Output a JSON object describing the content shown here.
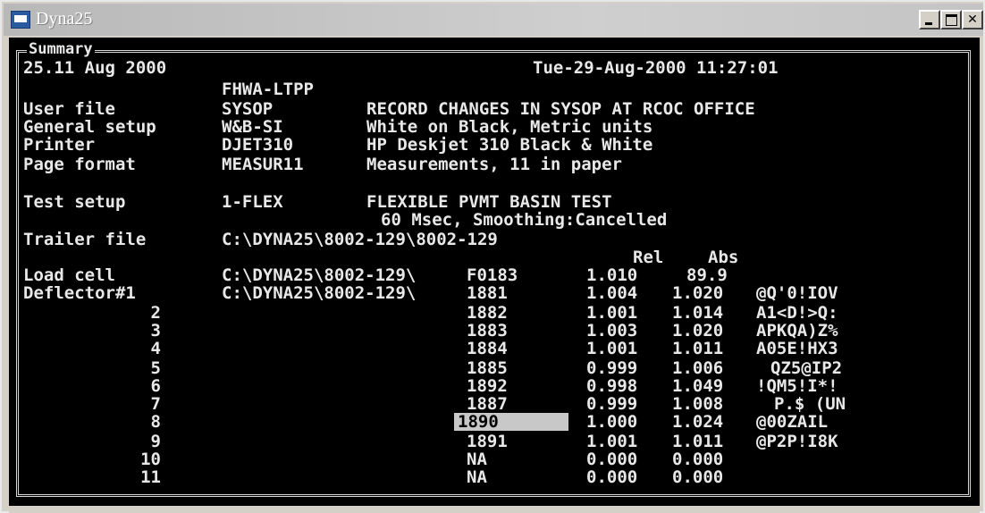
{
  "window": {
    "title": "Dyna25"
  },
  "summary": {
    "label": "Summary",
    "version": "25.11 Aug 2000",
    "datetime": "Tue-29-Aug-2000 11:27:01",
    "org": "FHWA-LTPP"
  },
  "rows": [
    {
      "label": "User file",
      "code": "SYSOP",
      "desc": "RECORD CHANGES IN SYSOP AT RCOC OFFICE"
    },
    {
      "label": "General setup",
      "code": "W&B-SI",
      "desc": "White on Black, Metric units"
    },
    {
      "label": "Printer",
      "code": "DJET310",
      "desc": "HP Deskjet 310 Black & White"
    },
    {
      "label": "Page format",
      "code": "MEASUR11",
      "desc": "Measurements, 11 in paper"
    }
  ],
  "test_setup": {
    "label": "Test setup",
    "code": "1-FLEX",
    "desc": "FLEXIBLE PVMT BASIN TEST",
    "desc2": "60 Msec, Smoothing:Cancelled"
  },
  "trailer": {
    "label": "Trailer file",
    "path": "C:\\DYNA25\\8002-129\\8002-129"
  },
  "sensor_headers": {
    "rel": "Rel",
    "abs": "Abs"
  },
  "load_cell": {
    "label": "Load cell",
    "path": "C:\\DYNA25\\8002-129\\",
    "serial": "F0183",
    "rel": "1.010",
    "abs": "89.9"
  },
  "deflectors": [
    {
      "label": "Deflector#1",
      "path": "C:\\DYNA25\\8002-129\\",
      "serial": "1881",
      "rel": "1.004",
      "abs": "1.020",
      "code": "@Q'0!IOV"
    },
    {
      "label": "2",
      "serial": "1882",
      "rel": "1.001",
      "abs": "1.014",
      "code": "A1<D!>Q:"
    },
    {
      "label": "3",
      "serial": "1883",
      "rel": "1.003",
      "abs": "1.020",
      "code": "APKQA)Z%"
    },
    {
      "label": "4",
      "serial": "1884",
      "rel": "1.001",
      "abs": "1.011",
      "code": "A05E!HX3"
    },
    {
      "label": "5",
      "serial": "1885",
      "rel": "0.999",
      "abs": "1.006",
      "code": "QZ5@IP2"
    },
    {
      "label": "6",
      "serial": "1892",
      "rel": "0.998",
      "abs": "1.049",
      "code": "!QM5!I*!"
    },
    {
      "label": "7",
      "serial": "1887",
      "rel": "0.999",
      "abs": "1.008",
      "code": "P.$ (UN"
    },
    {
      "label": "8",
      "serial": "1890",
      "rel": "1.000",
      "abs": "1.024",
      "code": "@00ZAIL",
      "selected": true
    },
    {
      "label": "9",
      "serial": "1891",
      "rel": "1.001",
      "abs": "1.011",
      "code": "@P2P!I8K"
    },
    {
      "label": "10",
      "serial": "NA",
      "rel": "0.000",
      "abs": "0.000",
      "code": ""
    },
    {
      "label": "11",
      "serial": "NA",
      "rel": "0.000",
      "abs": "0.000",
      "code": ""
    }
  ]
}
